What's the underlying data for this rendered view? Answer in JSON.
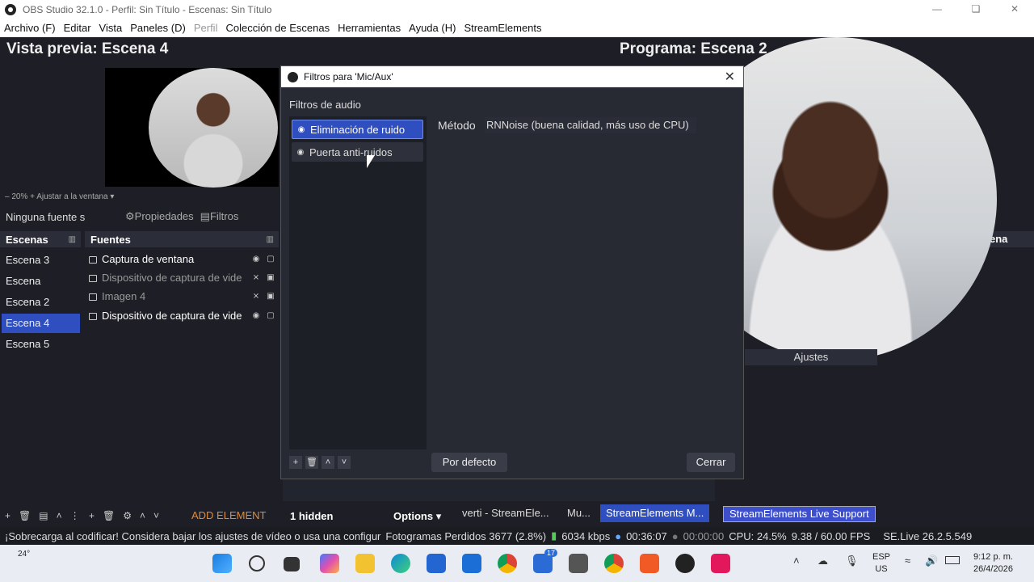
{
  "window": {
    "title": "OBS Studio 32.1.0 - Perfil: Sin Título - Escenas: Sin Título"
  },
  "menu": [
    "Archivo (F)",
    "Editar",
    "Vista",
    "Paneles (D)",
    "Perfil",
    "Colección de Escenas",
    "Herramientas",
    "Ayuda (H)",
    "StreamElements"
  ],
  "preview": {
    "label": "Vista previa: Escena 4",
    "zoom": "20%",
    "fit": "Ajustar a la ventana"
  },
  "program": {
    "label": "Programa: Escena 2"
  },
  "source_bar": {
    "none": "Ninguna fuente s",
    "props": "Propiedades",
    "filters": "Filtros"
  },
  "scenes": {
    "title": "Escenas",
    "items": [
      "Escena 3",
      "Escena",
      "Escena 2",
      "Escena 4",
      "Escena 5"
    ],
    "selected": "Escena 4"
  },
  "sources": {
    "title": "Fuentes",
    "items": [
      {
        "name": "Captura de ventana",
        "dim": false
      },
      {
        "name": "Dispositivo de captura de vide",
        "dim": true
      },
      {
        "name": "Imagen 4",
        "dim": true
      },
      {
        "name": "Dispositivo de captura de vide",
        "dim": false
      }
    ]
  },
  "bottom": {
    "add_element": "ADD ELEMENT",
    "hidden": "1 hidden",
    "options": "Options"
  },
  "dock_tabs": [
    "verti - StreamEle...",
    "Mu...",
    "StreamElements M...",
    "StreamElements Live Support"
  ],
  "right_dock": {
    "title_fragment": "ena",
    "ajustes": "Ajustes"
  },
  "status": {
    "warning": "¡Sobrecarga al codificar! Considera bajar los ajustes de vídeo o usa una configur",
    "dropped": "Fotogramas Perdidos 3677 (2.8%)",
    "bitrate": "6034 kbps",
    "stream_time": "00:36:07",
    "rec_time": "00:00:00",
    "cpu": "CPU: 24.5%",
    "fps": "9.38 / 60.00 FPS",
    "version": "SE.Live 26.2.5.549"
  },
  "dialog": {
    "title": "Filtros para 'Mic/Aux'",
    "section": "Filtros de audio",
    "filters": [
      "Eliminación de ruido",
      "Puerta anti-ruidos"
    ],
    "selected": "Eliminación de ruido",
    "method_label": "Método",
    "method_value": "RNNoise (buena calidad, más uso de CPU)",
    "default_btn": "Por defecto",
    "close_btn": "Cerrar"
  },
  "taskbar": {
    "weather": "24°",
    "badge": "17",
    "lang": "ESP",
    "region": "US",
    "time": "9:12 p. m.",
    "date": "26/4/2026"
  },
  "colors": {
    "accent": "#2f4ec0",
    "bg": "#1e1f26",
    "warn": "#e08a3a"
  }
}
